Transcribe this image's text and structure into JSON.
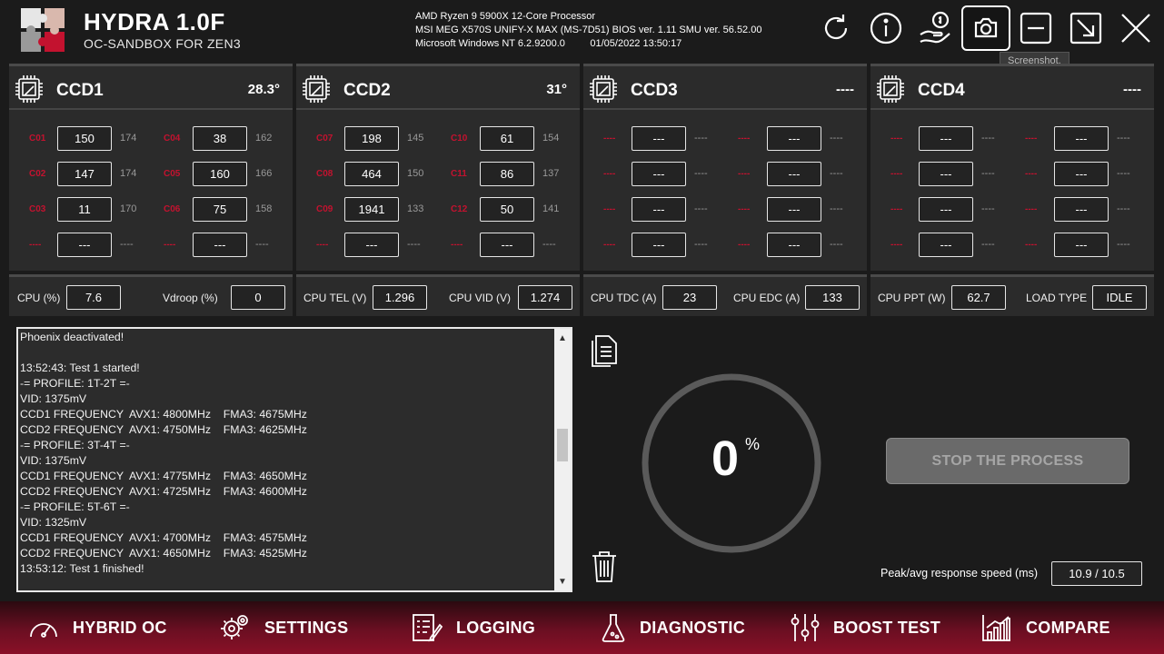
{
  "app": {
    "title": "HYDRA 1.0F",
    "subtitle": "OC-SANDBOX FOR ZEN3"
  },
  "system": {
    "cpu": "AMD Ryzen 9 5900X 12-Core Processor",
    "board": "MSI MEG X570S UNIFY-X MAX (MS-7D51) BIOS ver. 1.11 SMU ver. 56.52.00",
    "os_time": "Microsoft Windows NT 6.2.9200.0         01/05/2022 13:50:17"
  },
  "header_buttons": [
    "refresh-icon",
    "info-icon",
    "donate-icon",
    "screenshot-icon",
    "minimize-icon",
    "restore-icon",
    "close-icon"
  ],
  "tooltip": "Screenshot.",
  "ccds": [
    {
      "name": "CCD1",
      "temp": "28.3°",
      "left": [
        {
          "label": "C01",
          "value": "150",
          "max": "174"
        },
        {
          "label": "C02",
          "value": "147",
          "max": "174"
        },
        {
          "label": "C03",
          "value": "11",
          "max": "170"
        },
        {
          "label": "----",
          "value": "---",
          "max": "----"
        }
      ],
      "right": [
        {
          "label": "C04",
          "value": "38",
          "max": "162"
        },
        {
          "label": "C05",
          "value": "160",
          "max": "166"
        },
        {
          "label": "C06",
          "value": "75",
          "max": "158"
        },
        {
          "label": "----",
          "value": "---",
          "max": "----"
        }
      ]
    },
    {
      "name": "CCD2",
      "temp": "31°",
      "left": [
        {
          "label": "C07",
          "value": "198",
          "max": "145"
        },
        {
          "label": "C08",
          "value": "464",
          "max": "150"
        },
        {
          "label": "C09",
          "value": "1941",
          "max": "133"
        },
        {
          "label": "----",
          "value": "---",
          "max": "----"
        }
      ],
      "right": [
        {
          "label": "C10",
          "value": "61",
          "max": "154"
        },
        {
          "label": "C11",
          "value": "86",
          "max": "137"
        },
        {
          "label": "C12",
          "value": "50",
          "max": "141"
        },
        {
          "label": "----",
          "value": "---",
          "max": "----"
        }
      ]
    },
    {
      "name": "CCD3",
      "temp": "----",
      "left": [
        {
          "label": "----",
          "value": "---",
          "max": "----"
        },
        {
          "label": "----",
          "value": "---",
          "max": "----"
        },
        {
          "label": "----",
          "value": "---",
          "max": "----"
        },
        {
          "label": "----",
          "value": "---",
          "max": "----"
        }
      ],
      "right": [
        {
          "label": "----",
          "value": "---",
          "max": "----"
        },
        {
          "label": "----",
          "value": "---",
          "max": "----"
        },
        {
          "label": "----",
          "value": "---",
          "max": "----"
        },
        {
          "label": "----",
          "value": "---",
          "max": "----"
        }
      ]
    },
    {
      "name": "CCD4",
      "temp": "----",
      "left": [
        {
          "label": "----",
          "value": "---",
          "max": "----"
        },
        {
          "label": "----",
          "value": "---",
          "max": "----"
        },
        {
          "label": "----",
          "value": "---",
          "max": "----"
        },
        {
          "label": "----",
          "value": "---",
          "max": "----"
        }
      ],
      "right": [
        {
          "label": "----",
          "value": "---",
          "max": "----"
        },
        {
          "label": "----",
          "value": "---",
          "max": "----"
        },
        {
          "label": "----",
          "value": "---",
          "max": "----"
        },
        {
          "label": "----",
          "value": "---",
          "max": "----"
        }
      ]
    }
  ],
  "metrics": [
    {
      "label1": "CPU (%)",
      "value1": "7.6",
      "label2": "Vdroop (%)",
      "value2": "0"
    },
    {
      "label1": "CPU TEL (V)",
      "value1": "1.296",
      "label2": "CPU VID (V)",
      "value2": "1.274"
    },
    {
      "label1": "CPU TDC (A)",
      "value1": "23",
      "label2": "CPU EDC (A)",
      "value2": "133"
    },
    {
      "label1": "CPU PPT (W)",
      "value1": "62.7",
      "label2": "LOAD TYPE",
      "value2": "IDLE"
    }
  ],
  "log": {
    "lines": [
      "Phoenix deactivated!",
      "",
      "13:52:43: Test 1 started!",
      "-= PROFILE: 1T-2T =-",
      "VID: 1375mV",
      "CCD1 FREQUENCY  AVX1: 4800MHz    FMA3: 4675MHz",
      "CCD2 FREQUENCY  AVX1: 4750MHz    FMA3: 4625MHz",
      "-= PROFILE: 3T-4T =-",
      "VID: 1375mV",
      "CCD1 FREQUENCY  AVX1: 4775MHz    FMA3: 4650MHz",
      "CCD2 FREQUENCY  AVX1: 4725MHz    FMA3: 4600MHz",
      "-= PROFILE: 5T-6T =-",
      "VID: 1325mV",
      "CCD1 FREQUENCY  AVX1: 4700MHz    FMA3: 4575MHz",
      "CCD2 FREQUENCY  AVX1: 4650MHz    FMA3: 4525MHz",
      "13:53:12: Test 1 finished!"
    ]
  },
  "progress": {
    "value": "0",
    "percent_sign": "%",
    "fraction": 0
  },
  "stop_button": "STOP THE PROCESS",
  "response": {
    "label": "Peak/avg response speed (ms)",
    "value": "10.9 / 10.5"
  },
  "nav": [
    {
      "label": "HYBRID OC",
      "icon": "gauge-icon"
    },
    {
      "label": "SETTINGS",
      "icon": "gears-icon"
    },
    {
      "label": "LOGGING",
      "icon": "logging-icon"
    },
    {
      "label": "DIAGNOSTIC",
      "icon": "flask-icon"
    },
    {
      "label": "BOOST TEST",
      "icon": "sliders-icon"
    },
    {
      "label": "COMPARE",
      "icon": "bar-chart-icon"
    }
  ],
  "colors": {
    "accent": "#c3122f",
    "panel": "#2b2b2b",
    "background": "#1b1b1b"
  }
}
